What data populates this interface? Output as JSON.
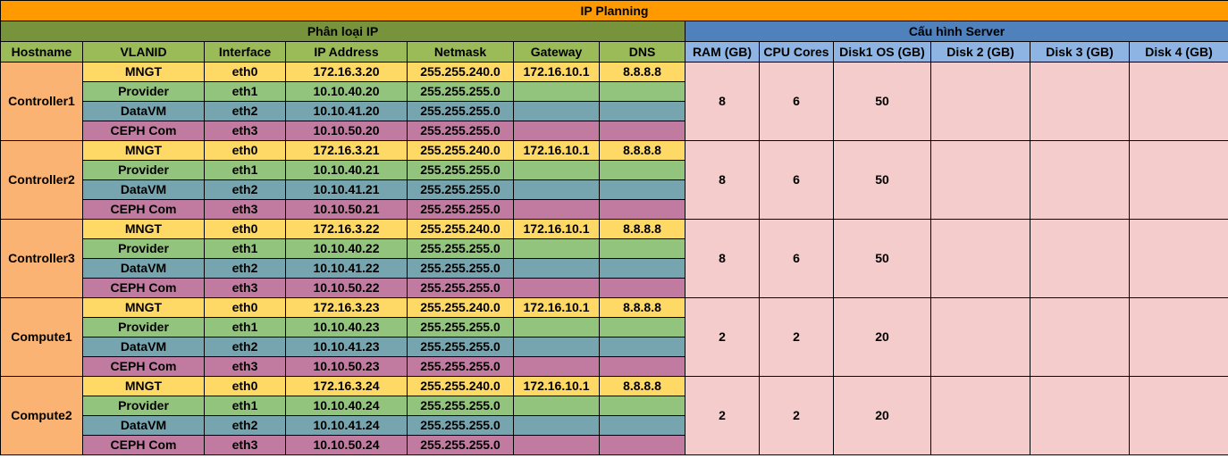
{
  "title": "IP Planning",
  "groups": {
    "ip": "Phân loại IP",
    "server": "Cấu hình Server"
  },
  "columns": {
    "hostname": "Hostname",
    "vlanid": "VLANID",
    "interface": "Interface",
    "ip": "IP Address",
    "netmask": "Netmask",
    "gateway": "Gateway",
    "dns": "DNS",
    "ram": "RAM (GB)",
    "cpu": "CPU Cores",
    "disk1": "Disk1 OS (GB)",
    "disk2": "Disk 2 (GB)",
    "disk3": "Disk 3 (GB)",
    "disk4": "Disk 4 (GB)"
  },
  "colors": {
    "title": "#ff9900",
    "ip_group": "#77933c",
    "server_group": "#4f81bd",
    "header": "#9bbb59",
    "server_header": "#8db4e2",
    "host": "#fab373",
    "mngt": "#ffd966",
    "provider": "#93c47d",
    "datavm": "#76a5af",
    "ceph": "#c27ba0",
    "server": "#f4cccc"
  },
  "hosts": [
    {
      "name": "Controller1",
      "ram": "8",
      "cpu": "6",
      "disk1": "50",
      "disk2": "",
      "disk3": "",
      "disk4": "",
      "interfaces": [
        {
          "vlan": "MNGT",
          "iface": "eth0",
          "ip": "172.16.3.20",
          "netmask": "255.255.240.0",
          "gateway": "172.16.10.1",
          "dns": "8.8.8.8"
        },
        {
          "vlan": "Provider",
          "iface": "eth1",
          "ip": "10.10.40.20",
          "netmask": "255.255.255.0",
          "gateway": "",
          "dns": ""
        },
        {
          "vlan": "DataVM",
          "iface": "eth2",
          "ip": "10.10.41.20",
          "netmask": "255.255.255.0",
          "gateway": "",
          "dns": ""
        },
        {
          "vlan": "CEPH Com",
          "iface": "eth3",
          "ip": "10.10.50.20",
          "netmask": "255.255.255.0",
          "gateway": "",
          "dns": ""
        }
      ]
    },
    {
      "name": "Controller2",
      "ram": "8",
      "cpu": "6",
      "disk1": "50",
      "disk2": "",
      "disk3": "",
      "disk4": "",
      "interfaces": [
        {
          "vlan": "MNGT",
          "iface": "eth0",
          "ip": "172.16.3.21",
          "netmask": "255.255.240.0",
          "gateway": "172.16.10.1",
          "dns": "8.8.8.8"
        },
        {
          "vlan": "Provider",
          "iface": "eth1",
          "ip": "10.10.40.21",
          "netmask": "255.255.255.0",
          "gateway": "",
          "dns": ""
        },
        {
          "vlan": "DataVM",
          "iface": "eth2",
          "ip": "10.10.41.21",
          "netmask": "255.255.255.0",
          "gateway": "",
          "dns": ""
        },
        {
          "vlan": "CEPH Com",
          "iface": "eth3",
          "ip": "10.10.50.21",
          "netmask": "255.255.255.0",
          "gateway": "",
          "dns": ""
        }
      ]
    },
    {
      "name": "Controller3",
      "ram": "8",
      "cpu": "6",
      "disk1": "50",
      "disk2": "",
      "disk3": "",
      "disk4": "",
      "interfaces": [
        {
          "vlan": "MNGT",
          "iface": "eth0",
          "ip": "172.16.3.22",
          "netmask": "255.255.240.0",
          "gateway": "172.16.10.1",
          "dns": "8.8.8.8"
        },
        {
          "vlan": "Provider",
          "iface": "eth1",
          "ip": "10.10.40.22",
          "netmask": "255.255.255.0",
          "gateway": "",
          "dns": ""
        },
        {
          "vlan": "DataVM",
          "iface": "eth2",
          "ip": "10.10.41.22",
          "netmask": "255.255.255.0",
          "gateway": "",
          "dns": ""
        },
        {
          "vlan": "CEPH Com",
          "iface": "eth3",
          "ip": "10.10.50.22",
          "netmask": "255.255.255.0",
          "gateway": "",
          "dns": ""
        }
      ]
    },
    {
      "name": "Compute1",
      "ram": "2",
      "cpu": "2",
      "disk1": "20",
      "disk2": "",
      "disk3": "",
      "disk4": "",
      "interfaces": [
        {
          "vlan": "MNGT",
          "iface": "eth0",
          "ip": "172.16.3.23",
          "netmask": "255.255.240.0",
          "gateway": "172.16.10.1",
          "dns": "8.8.8.8"
        },
        {
          "vlan": "Provider",
          "iface": "eth1",
          "ip": "10.10.40.23",
          "netmask": "255.255.255.0",
          "gateway": "",
          "dns": ""
        },
        {
          "vlan": "DataVM",
          "iface": "eth2",
          "ip": "10.10.41.23",
          "netmask": "255.255.255.0",
          "gateway": "",
          "dns": ""
        },
        {
          "vlan": "CEPH Com",
          "iface": "eth3",
          "ip": "10.10.50.23",
          "netmask": "255.255.255.0",
          "gateway": "",
          "dns": ""
        }
      ]
    },
    {
      "name": "Compute2",
      "ram": "2",
      "cpu": "2",
      "disk1": "20",
      "disk2": "",
      "disk3": "",
      "disk4": "",
      "interfaces": [
        {
          "vlan": "MNGT",
          "iface": "eth0",
          "ip": "172.16.3.24",
          "netmask": "255.255.240.0",
          "gateway": "172.16.10.1",
          "dns": "8.8.8.8"
        },
        {
          "vlan": "Provider",
          "iface": "eth1",
          "ip": "10.10.40.24",
          "netmask": "255.255.255.0",
          "gateway": "",
          "dns": ""
        },
        {
          "vlan": "DataVM",
          "iface": "eth2",
          "ip": "10.10.41.24",
          "netmask": "255.255.255.0",
          "gateway": "",
          "dns": ""
        },
        {
          "vlan": "CEPH Com",
          "iface": "eth3",
          "ip": "10.10.50.24",
          "netmask": "255.255.255.0",
          "gateway": "",
          "dns": ""
        }
      ]
    }
  ]
}
